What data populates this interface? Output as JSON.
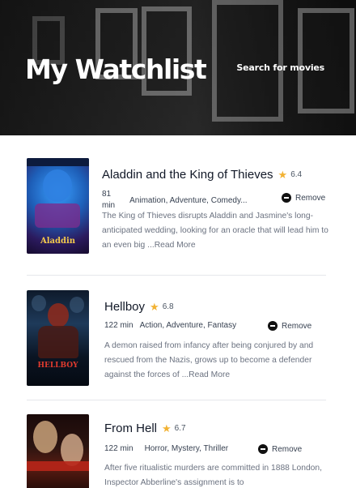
{
  "header": {
    "title": "My Watchlist",
    "search_link": "Search for movies"
  },
  "colors": {
    "star": "#f2b233",
    "text_primary": "#111827",
    "text_muted": "#6b7280"
  },
  "movies": [
    {
      "title": "Aladdin and the King of Thieves",
      "rating": "6.4",
      "runtime_line1": "81",
      "runtime_line2": "min",
      "genres": "Animation, Adventure, Comedy...",
      "remove_label": "Remove",
      "overview": "The King of Thieves disrupts Aladdin and Jasmine's long-anticipated wedding, looking for an oracle that will lead him to an even big ...",
      "read_more": "Read More",
      "poster_text": "Aladdin"
    },
    {
      "title": "Hellboy",
      "rating": "6.8",
      "runtime": "122 min",
      "genres": "Action, Adventure, Fantasy",
      "remove_label": "Remove",
      "overview": "A demon raised from infancy after being conjured by and rescued from the Nazis, grows up to become a defender against the forces of ...",
      "read_more": "Read More",
      "poster_text": "HELLBOY"
    },
    {
      "title": "From Hell",
      "rating": "6.7",
      "runtime": "122 min",
      "genres": "Horror, Mystery, Thriller",
      "remove_label": "Remove",
      "overview": "After five ritualistic murders are committed in 1888 London, Inspector Abberline's assignment is to",
      "poster_text": ""
    }
  ]
}
